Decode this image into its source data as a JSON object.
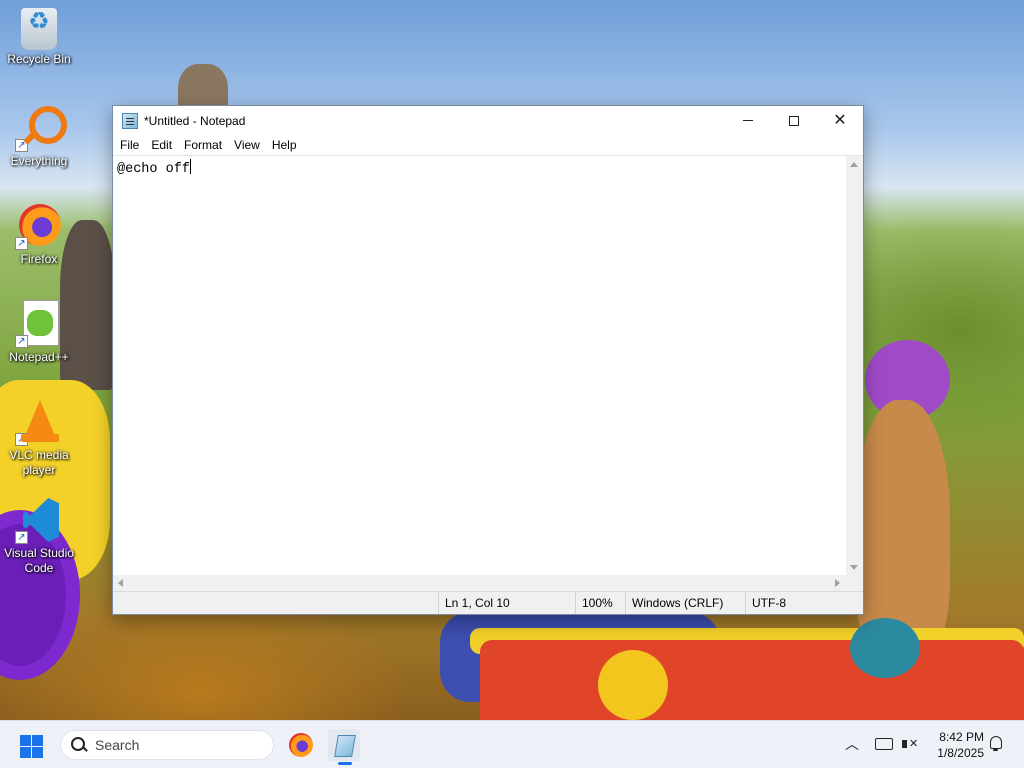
{
  "desktop": {
    "icons": [
      {
        "label": "Recycle Bin",
        "icon": "recycle-bin-icon"
      },
      {
        "label": "Everything",
        "icon": "everything-search-icon"
      },
      {
        "label": "Firefox",
        "icon": "firefox-icon"
      },
      {
        "label": "Notepad++",
        "icon": "notepad-plus-plus-icon"
      },
      {
        "label": "VLC media player",
        "icon": "vlc-icon"
      },
      {
        "label": "Visual Studio Code",
        "icon": "vscode-icon"
      }
    ]
  },
  "window": {
    "title": "*Untitled - Notepad",
    "controls": {
      "minimize": "minimize",
      "maximize": "maximize",
      "close": "close"
    },
    "menu": [
      "File",
      "Edit",
      "Format",
      "View",
      "Help"
    ],
    "content": "@echo off",
    "status": {
      "position": "Ln 1, Col 10",
      "zoom": "100%",
      "line_ending": "Windows (CRLF)",
      "encoding": "UTF-8"
    }
  },
  "taskbar": {
    "search_placeholder": "Search",
    "pinned": [
      "firefox-icon",
      "notepad-icon"
    ],
    "active_app": "notepad-icon",
    "clock_time": "8:42 PM",
    "clock_date": "1/8/2025"
  },
  "colors": {
    "accent": "#1a73e8",
    "window_border": "#7a8aa0",
    "statusbar_bg": "#f0f0f0"
  }
}
